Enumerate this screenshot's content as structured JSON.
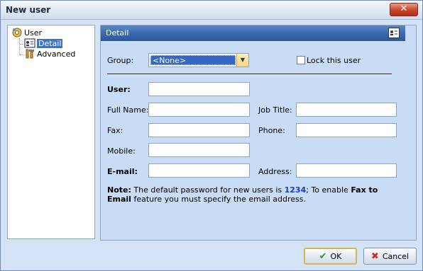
{
  "window": {
    "title": "New user",
    "close_label": "✕"
  },
  "tree": {
    "root": {
      "label": "User"
    },
    "items": [
      {
        "label": "Detail",
        "selected": true
      },
      {
        "label": "Advanced",
        "selected": false
      }
    ]
  },
  "panel": {
    "title": "Detail",
    "group_label": "Group:",
    "group_value": "<None>",
    "lock_label": "Lock this user",
    "lock_checked": false,
    "fields": {
      "user": {
        "label": "User:",
        "value": ""
      },
      "full_name": {
        "label": "Full Name:",
        "value": ""
      },
      "job_title": {
        "label": "Job Title:",
        "value": ""
      },
      "fax": {
        "label": "Fax:",
        "value": ""
      },
      "phone": {
        "label": "Phone:",
        "value": ""
      },
      "mobile": {
        "label": "Mobile:",
        "value": ""
      },
      "email": {
        "label": "E-mail:",
        "value": ""
      },
      "address": {
        "label": "Address:",
        "value": ""
      }
    },
    "note": {
      "prefix": "Note:",
      "text1": " The default password for new users is ",
      "password": "1234",
      "text2": "; To enable ",
      "feature": "Fax to Email",
      "text3": " feature you must specify the email address."
    }
  },
  "buttons": {
    "ok": "OK",
    "cancel": "Cancel"
  },
  "icons": {
    "ok": "check-icon",
    "cancel": "x-icon"
  }
}
